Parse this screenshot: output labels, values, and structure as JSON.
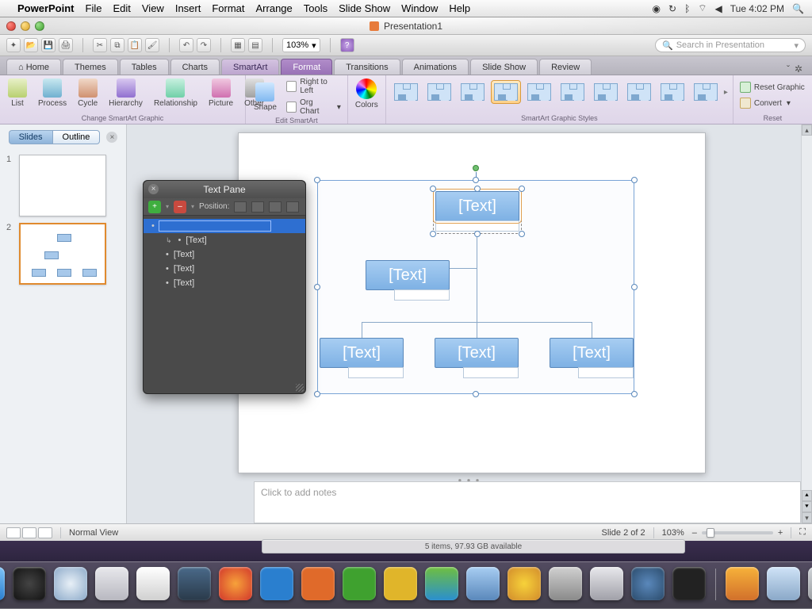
{
  "menubar": {
    "app": "PowerPoint",
    "items": [
      "File",
      "Edit",
      "View",
      "Insert",
      "Format",
      "Arrange",
      "Tools",
      "Slide Show",
      "Window",
      "Help"
    ],
    "clock": "Tue 4:02 PM"
  },
  "window": {
    "title": "Presentation1"
  },
  "qat": {
    "zoom": "103%",
    "search_placeholder": "Search in Presentation"
  },
  "ribbon_tabs": [
    "Home",
    "Themes",
    "Tables",
    "Charts",
    "SmartArt",
    "Format",
    "Transitions",
    "Animations",
    "Slide Show",
    "Review"
  ],
  "ribbon_active_tab": "Format",
  "ribbon_highlight_tab": "SmartArt",
  "ribbon": {
    "group_change": "Change SmartArt Graphic",
    "btn_list": "List",
    "btn_process": "Process",
    "btn_cycle": "Cycle",
    "btn_hierarchy": "Hierarchy",
    "btn_relationship": "Relationship",
    "btn_picture": "Picture",
    "btn_other": "Other",
    "group_edit": "Edit SmartArt",
    "btn_shape": "Shape",
    "btn_rtl": "Right to Left",
    "btn_orgchart": "Org Chart",
    "btn_colors": "Colors",
    "group_styles": "SmartArt Graphic Styles",
    "group_reset": "Reset",
    "btn_reset": "Reset Graphic",
    "btn_convert": "Convert"
  },
  "slides_panel": {
    "tab_slides": "Slides",
    "tab_outline": "Outline",
    "thumbs": [
      {
        "num": "1",
        "selected": false
      },
      {
        "num": "2",
        "selected": true
      }
    ]
  },
  "textpane": {
    "title": "Text Pane",
    "position_label": "Position:",
    "items": [
      {
        "level": 0,
        "text": "",
        "selected": true,
        "editing": true
      },
      {
        "level": 1,
        "text": "[Text]"
      },
      {
        "level": 1,
        "text": "[Text]"
      },
      {
        "level": 1,
        "text": "[Text]"
      },
      {
        "level": 1,
        "text": "[Text]"
      }
    ]
  },
  "smartart": {
    "placeholder": "[Text]"
  },
  "notes": {
    "placeholder": "Click to add notes"
  },
  "statusbar": {
    "view_label": "Normal View",
    "slide_indicator": "Slide 2 of 2",
    "zoom": "103%"
  },
  "finder_strip": "5 items, 97.93 GB available",
  "dock": {
    "icons": [
      {
        "name": "finder",
        "color": "linear-gradient(#7ec3f7,#2a7fcf)"
      },
      {
        "name": "dashboard",
        "color": "radial-gradient(circle,#444,#111)"
      },
      {
        "name": "safari",
        "color": "radial-gradient(circle,#e8f0f7,#8aa8c8)"
      },
      {
        "name": "mail",
        "color": "linear-gradient(#e8e8ec,#b8b8c0)"
      },
      {
        "name": "ical",
        "color": "linear-gradient(#fff,#d0d0d0)"
      },
      {
        "name": "preview",
        "color": "linear-gradient(#4a6a8a,#2a3a4a)"
      },
      {
        "name": "firefox",
        "color": "radial-gradient(circle,#f7a23a,#d1352b)"
      },
      {
        "name": "word",
        "color": "#2a7fcf"
      },
      {
        "name": "powerpoint",
        "color": "#e06a2a"
      },
      {
        "name": "excel",
        "color": "#3fa12f"
      },
      {
        "name": "outlook",
        "color": "#e0b52a"
      },
      {
        "name": "messenger",
        "color": "linear-gradient(#6fbf3f,#2a8fcf)"
      },
      {
        "name": "communicator",
        "color": "linear-gradient(#a7cdf2,#5a88bb)"
      },
      {
        "name": "itunes",
        "color": "radial-gradient(circle,#f7d23a,#d18a2b)"
      },
      {
        "name": "rdp",
        "color": "linear-gradient(#d0d0d0,#8a8a8a)"
      },
      {
        "name": "automator",
        "color": "linear-gradient(#e8e8ec,#a0a0a8)"
      },
      {
        "name": "quicktime",
        "color": "radial-gradient(circle,#5a88bb,#2a4a6a)"
      },
      {
        "name": "terminal",
        "color": "#222"
      }
    ],
    "right_icons": [
      {
        "name": "applications",
        "color": "linear-gradient(#f7b23a,#d1702b)"
      },
      {
        "name": "documents",
        "color": "linear-gradient(#cfe3f7,#8aa8c8)"
      },
      {
        "name": "trash",
        "color": "linear-gradient(#d0d4d8,#9a9ea2)"
      }
    ]
  }
}
